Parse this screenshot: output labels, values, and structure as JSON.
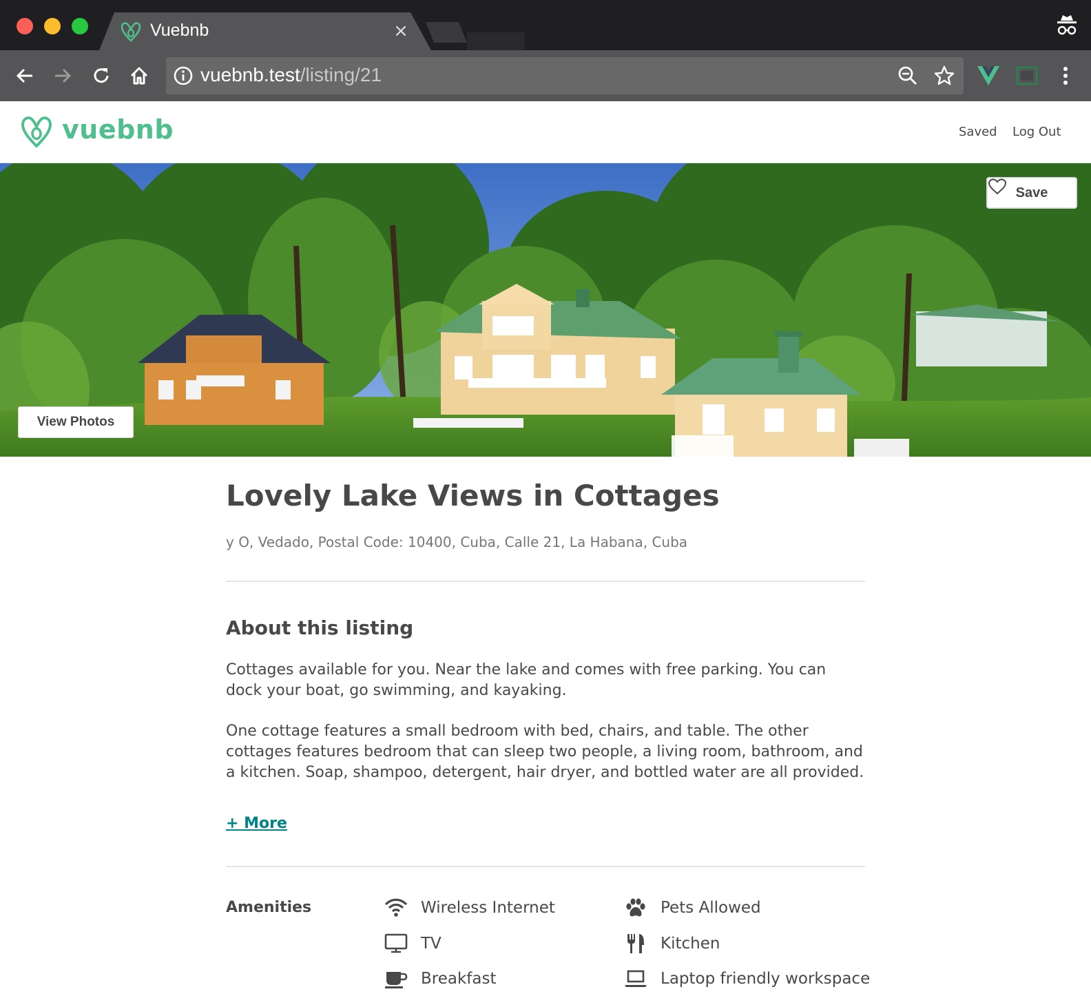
{
  "browser": {
    "tab_title": "Vuebnb",
    "tab_close": "×",
    "url_host": "vuebnb.test",
    "url_path": "/listing/21"
  },
  "header": {
    "logo_text": "vuebnb",
    "nav": {
      "saved": "Saved",
      "logout": "Log Out"
    }
  },
  "hero": {
    "save_label": "Save",
    "view_photos_label": "View Photos"
  },
  "listing": {
    "title": "Lovely Lake Views in Cottages",
    "address": "y O, Vedado, Postal Code: 10400, Cuba, Calle 21, La Habana, Cuba"
  },
  "about": {
    "heading": "About this listing",
    "paragraph_1": "Cottages available for you. Near the lake and comes with free parking. You can dock your boat, go swimming, and kayaking.",
    "paragraph_2": "One cottage features a small bedroom with bed, chairs, and table. The other cottages features bedroom that can sleep two people, a living room, bathroom, and a kitchen. Soap, shampoo, detergent, hair dryer, and bottled water are all provided.",
    "more_label": "+ More"
  },
  "amenities": {
    "heading": "Amenities",
    "items": [
      {
        "label": "Wireless Internet",
        "icon": "wifi-icon"
      },
      {
        "label": "Pets Allowed",
        "icon": "paw-icon"
      },
      {
        "label": "TV",
        "icon": "tv-icon"
      },
      {
        "label": "Kitchen",
        "icon": "kitchen-icon"
      },
      {
        "label": "Breakfast",
        "icon": "coffee-cup-icon"
      },
      {
        "label": "Laptop friendly workspace",
        "icon": "laptop-icon"
      }
    ]
  },
  "colors": {
    "brand": "#4fc08d",
    "link": "#008489",
    "text": "#484848",
    "muted": "#767676"
  }
}
